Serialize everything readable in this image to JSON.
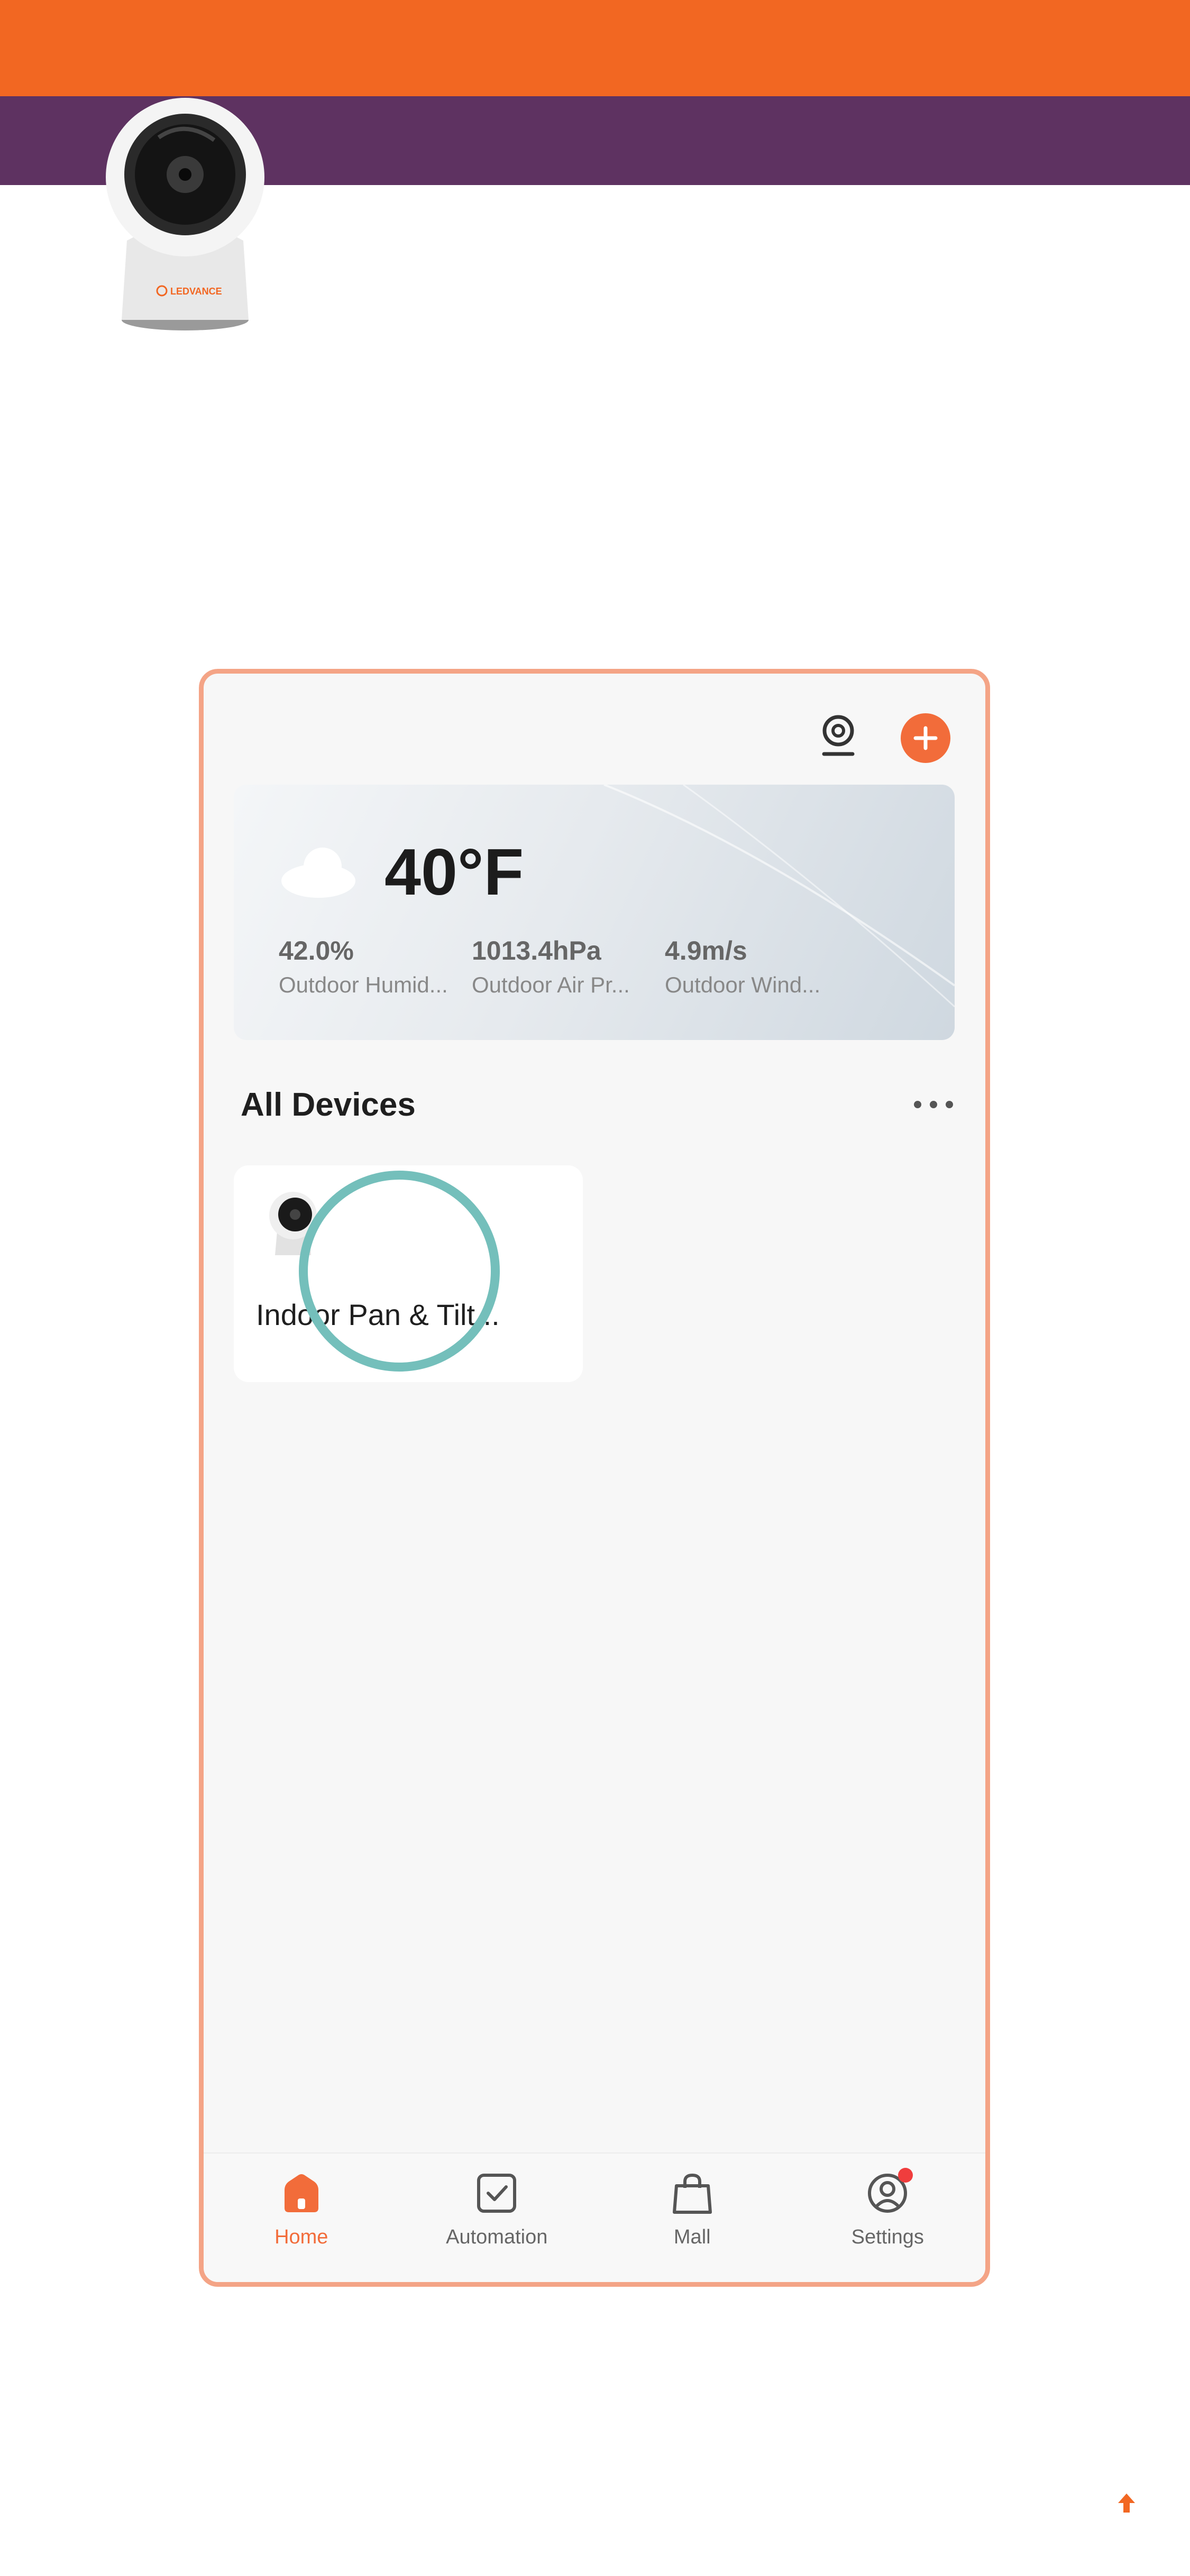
{
  "hero": {
    "brand_text": "LEDVANCE"
  },
  "weather": {
    "temperature": "40°F",
    "stats": [
      {
        "value": "42.0%",
        "label": "Outdoor Humid..."
      },
      {
        "value": "1013.4hPa",
        "label": "Outdoor Air Pr..."
      },
      {
        "value": "4.9m/s",
        "label": "Outdoor Wind..."
      }
    ]
  },
  "devices": {
    "title": "All Devices",
    "items": [
      {
        "name": "Indoor Pan & Tilt..."
      }
    ]
  },
  "tabs": [
    {
      "label": "Home",
      "icon": "home-icon",
      "active": true
    },
    {
      "label": "Automation",
      "icon": "checkbox-icon",
      "active": false
    },
    {
      "label": "Mall",
      "icon": "shopping-bag-icon",
      "active": false
    },
    {
      "label": "Settings",
      "icon": "user-icon",
      "active": false
    }
  ],
  "colors": {
    "accent": "#f26c3a",
    "brand_orange": "#f26722",
    "brand_purple": "#5e3261",
    "touch_ring": "#74bfbb"
  }
}
